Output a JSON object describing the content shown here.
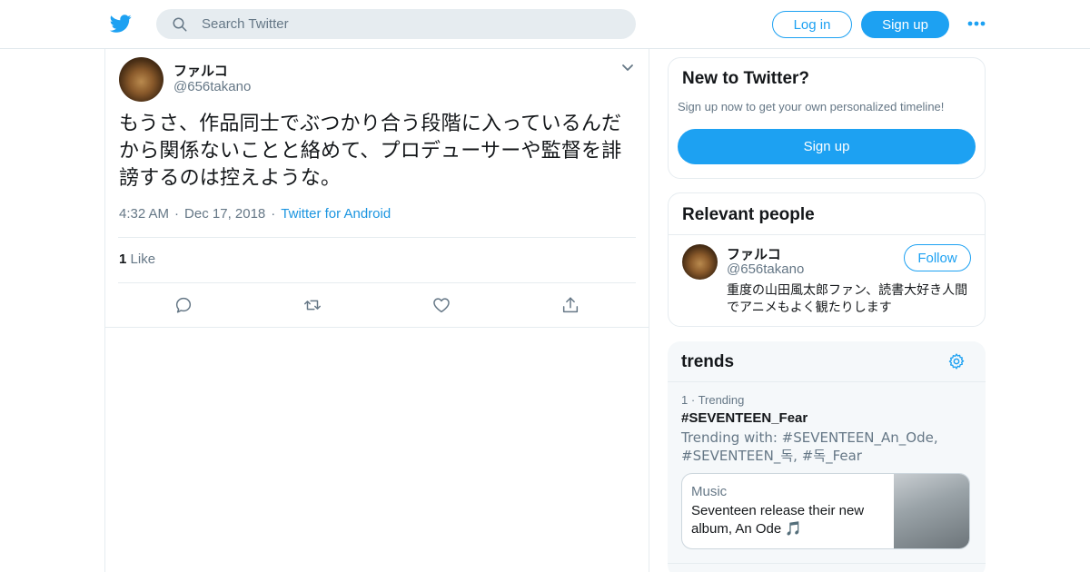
{
  "header": {
    "search_placeholder": "Search Twitter",
    "login_label": "Log in",
    "signup_label": "Sign up"
  },
  "tweet": {
    "display_name": "ファルコ",
    "handle": "@656takano",
    "text": "もうさ、作品同士でぶつかり合う段階に入っているんだから関係ないことと絡めて、プロデューサーや監督を誹謗するのは控えような。",
    "time": "4:32 AM",
    "date": "Dec 17, 2018",
    "source": "Twitter for Android",
    "like_count": "1",
    "like_label": "Like"
  },
  "new_to_twitter": {
    "title": "New to Twitter?",
    "subtitle": "Sign up now to get your own personalized timeline!",
    "button": "Sign up"
  },
  "relevant_people": {
    "title": "Relevant people",
    "person": {
      "display_name": "ファルコ",
      "handle": "@656takano",
      "bio": "重度の山田風太郎ファン、読書大好き人間でアニメもよく観たりします",
      "follow_label": "Follow"
    }
  },
  "trends": {
    "title": "trends",
    "items": [
      {
        "rank": "1",
        "context": "Trending",
        "name": "#SEVENTEEN_Fear",
        "trending_with": "Trending with: #SEVENTEEN_An_Ode, #SEVENTEEN_독, #독_Fear",
        "news": {
          "category": "Music",
          "title": "Seventeen release their new album, An Ode",
          "emoji": "🎵"
        }
      }
    ]
  },
  "colors": {
    "brand": "#1da1f2",
    "text": "#14171a",
    "muted": "#657786",
    "border": "#e6ecf0"
  },
  "icons": [
    "twitter-bird-icon",
    "search-icon",
    "more-dots-icon",
    "chevron-down-icon",
    "reply-icon",
    "retweet-icon",
    "like-heart-icon",
    "share-icon",
    "settings-gear-icon"
  ]
}
